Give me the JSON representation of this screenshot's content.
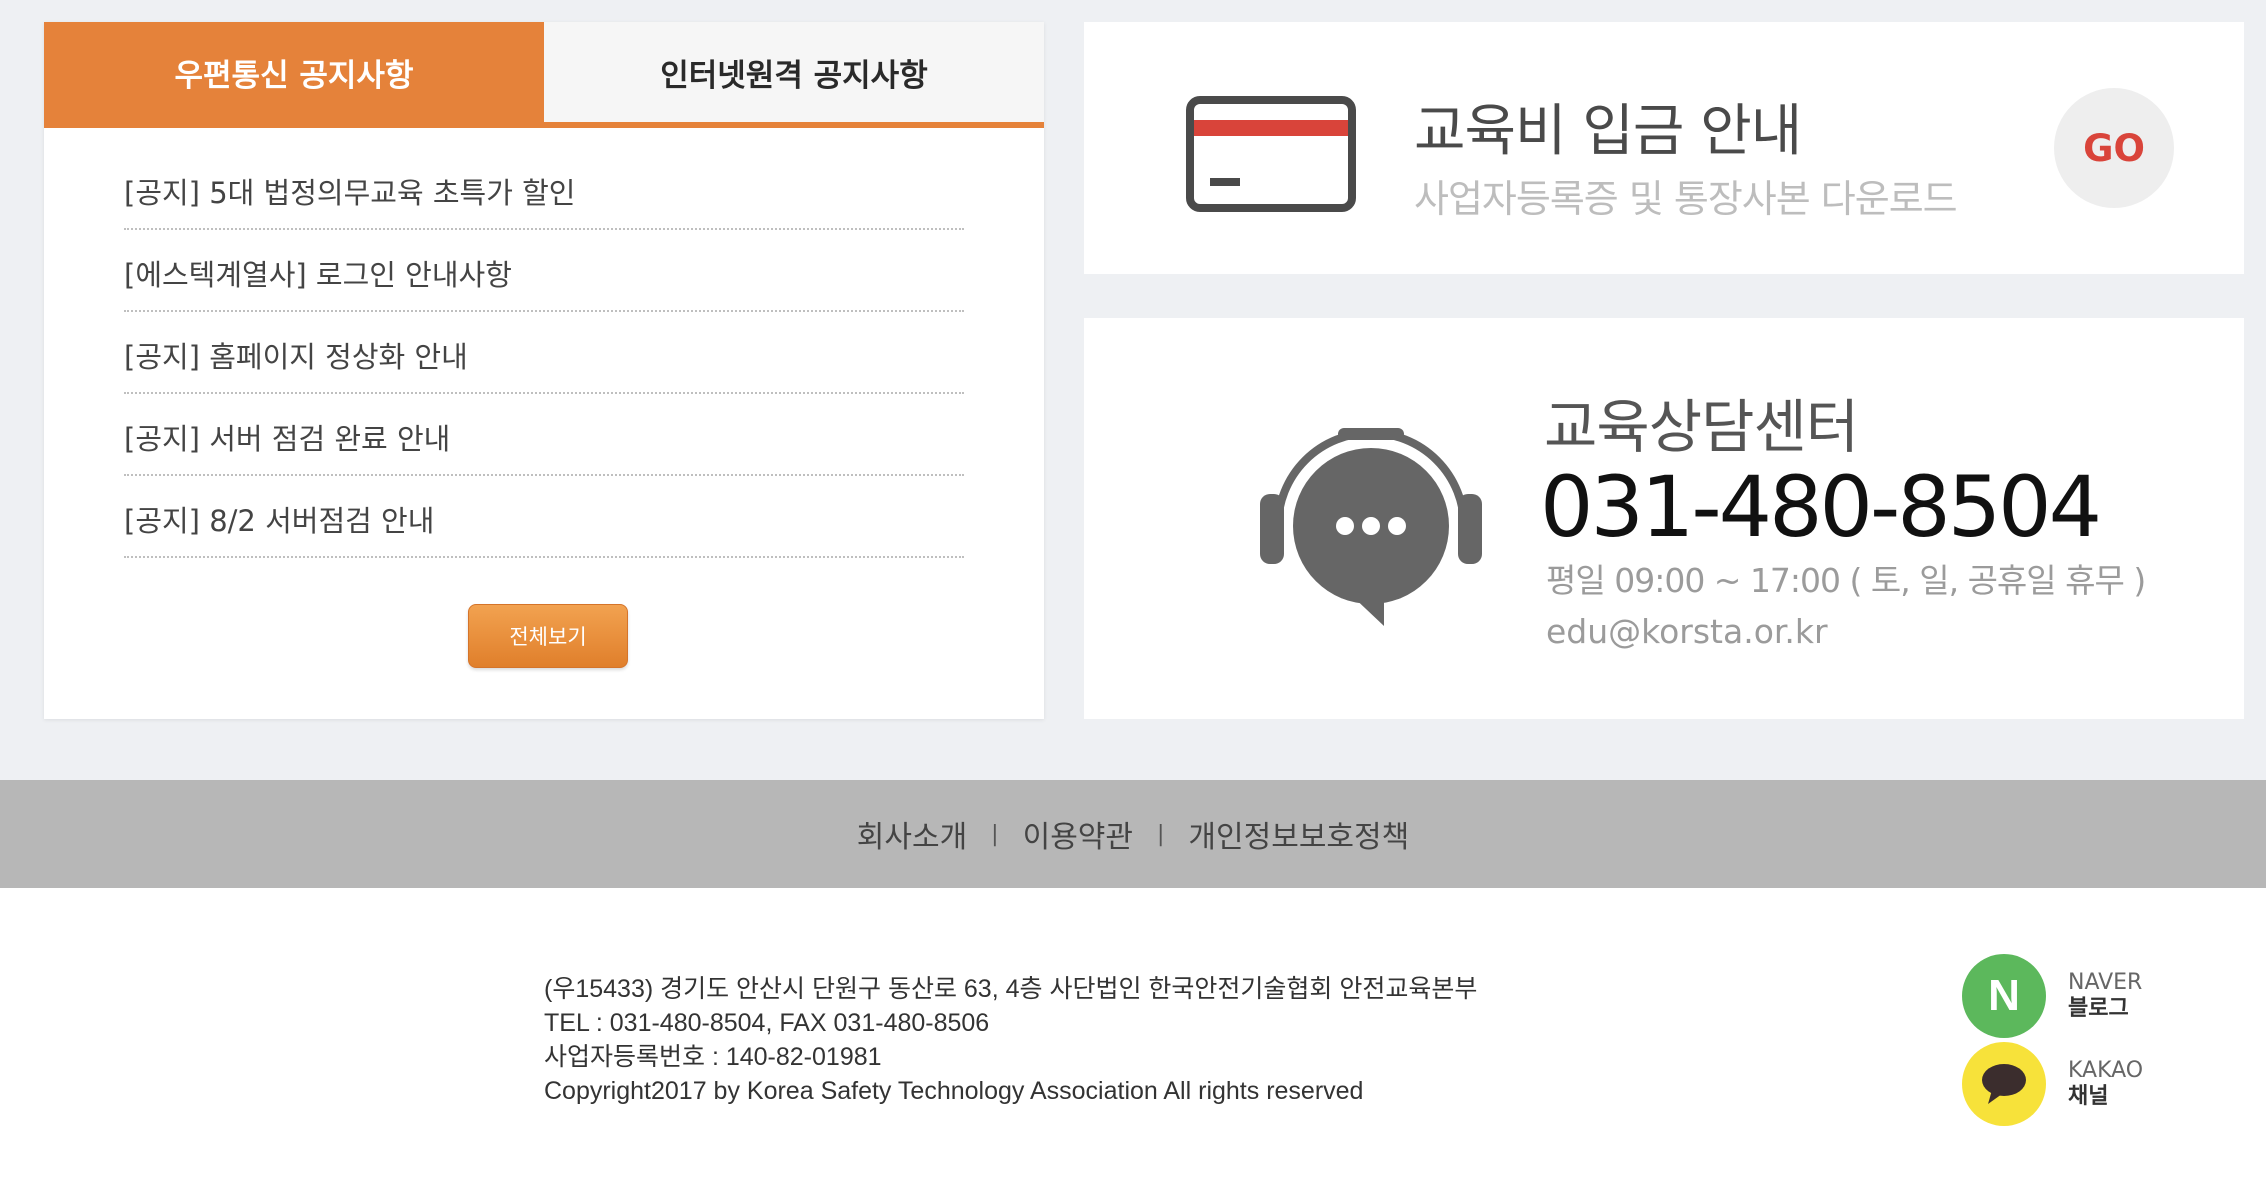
{
  "notice": {
    "tabs": [
      {
        "label": "우편통신 공지사항",
        "active": true
      },
      {
        "label": "인터넷원격 공지사항",
        "active": false
      }
    ],
    "items": [
      "[공지] 5대 법정의무교육 초특가 할인",
      "[에스텍계열사] 로그인 안내사항",
      "[공지] 홈페이지 정상화 안내",
      "[공지] 서버 점검 완료 안내",
      "[공지] 8/2 서버점검 안내"
    ],
    "more_label": "전체보기"
  },
  "payment": {
    "title": "교육비 입금 안내",
    "subtitle": "사업자등록증 및 통장사본 다운로드",
    "go_label": "GO",
    "icon": "credit-card-icon"
  },
  "consult": {
    "title": "교육상담센터",
    "phone": "031-480-8504",
    "hours": "평일 09:00 ~ 17:00 ( 토, 일, 공휴일 휴무 )",
    "email": "edu@korsta.or.kr",
    "icon": "headset-chat-icon"
  },
  "footer_nav": {
    "links": [
      "회사소개",
      "이용약관",
      "개인정보보호정책"
    ],
    "separator": "|"
  },
  "footer_info": {
    "lines": [
      "(우15433) 경기도 안산시 단원구 동산로 63, 4층 사단법인 한국안전기술협회 안전교육본부",
      "TEL : 031-480-8504, FAX 031-480-8506",
      "사업자등록번호 : 140-82-01981",
      "Copyright2017 by Korea Safety Technology Association All rights reserved"
    ]
  },
  "sns": {
    "naver": {
      "logo": "N",
      "name": "NAVER",
      "sub": "블로그",
      "color": "#5cb85c"
    },
    "kakao": {
      "name": "KAKAO",
      "sub": "채널",
      "color": "#f7e23a"
    }
  },
  "colors": {
    "accent": "#e5823a",
    "go_red": "#d9443a",
    "card_stripe": "#d9443a"
  }
}
